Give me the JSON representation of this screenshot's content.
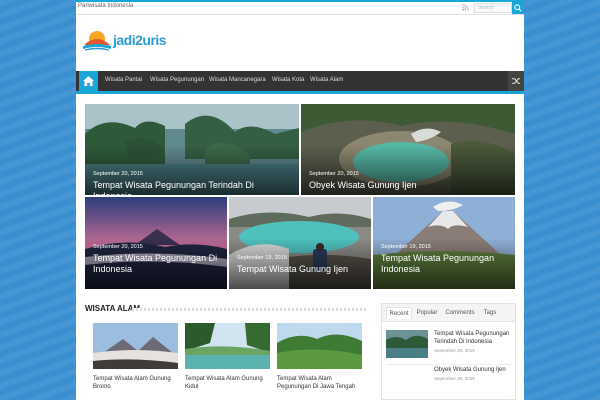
{
  "topbar": {
    "breadcrumb": "Pariwisata Indonesia",
    "search_placeholder": "Search",
    "rss_icon": "rss-icon",
    "search_icon": "search-icon"
  },
  "logo": {
    "text": "jadi2uris"
  },
  "nav": {
    "home_icon": "home-icon",
    "random_icon": "shuffle-icon",
    "items": [
      "Wisata Pantai",
      "Wisata Pegunungan",
      "Wisata Mancanegara",
      "Wisata Kota",
      "Wisata Alam"
    ]
  },
  "featured": [
    {
      "date": "September 20, 2015",
      "title": "Tempat Wisata Pegunungan Terindah Di Indonesia"
    },
    {
      "date": "September 20, 2015",
      "title": "Obyek Wisata Gunung Ijen"
    },
    {
      "date": "September 20, 2015",
      "title": "Tempat Wisata Pegunungan Di Indonesia"
    },
    {
      "date": "September 19, 2015",
      "title": "Tempat Wisata Gunung Ijen"
    },
    {
      "date": "September 19, 2015",
      "title": "Tempat Wisata Pegunungan Indonesia"
    }
  ],
  "section": {
    "title": "WISATA ALAM",
    "cards": [
      {
        "title": "Tempat Wisata Alam Gunung Bromo"
      },
      {
        "title": "Tempat Wisata Alam Gunung Kidul"
      },
      {
        "title": "Tempat Wisata Alam Pegunungan Di Jawa Tengah"
      }
    ]
  },
  "sidebar": {
    "tabs": [
      "Recent",
      "Popular",
      "Comments",
      "Tags"
    ],
    "recent": [
      {
        "title": "Tempat Wisata Pegunungan Terindah Di Indonesia",
        "date": "September 20, 2015"
      },
      {
        "title": "Obyek Wisata Gunung Ijen",
        "date": "September 20, 2015"
      }
    ]
  },
  "colors": {
    "accent": "#1aa6d8",
    "nav_bg": "#333333",
    "body_bg": "#3a8fd0"
  }
}
